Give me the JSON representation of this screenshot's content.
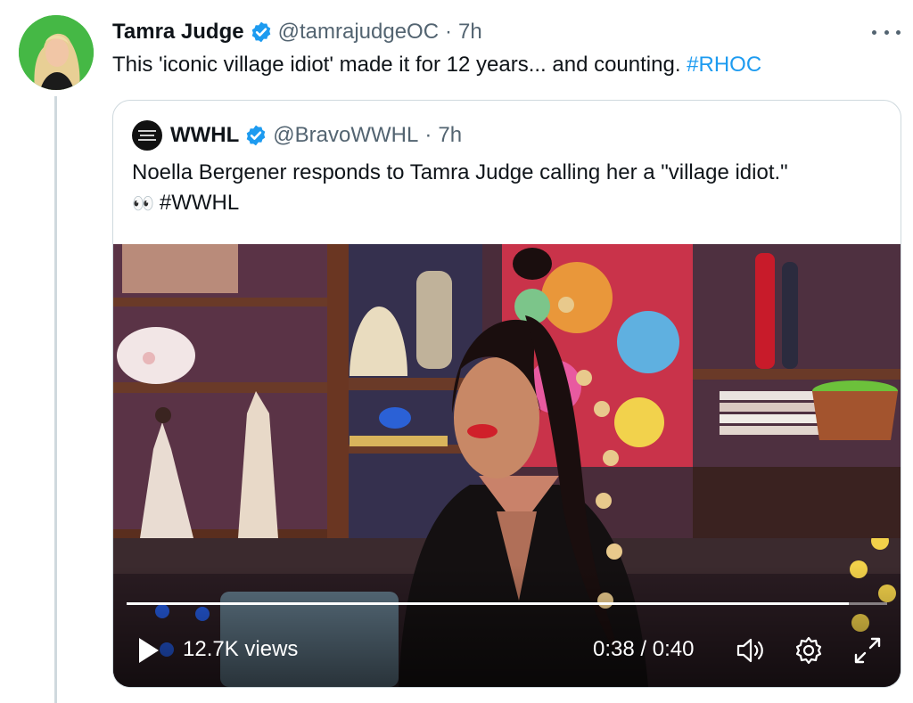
{
  "tweet": {
    "author_name": "Tamra Judge",
    "handle": "@tamrajudgeOC",
    "separator": "·",
    "time": "7h",
    "text": "This 'iconic village idiot' made it for 12 years... and counting.",
    "hashtag": "#RHOC"
  },
  "quote": {
    "author_name": "WWHL",
    "handle": "@BravoWWHL",
    "separator": "·",
    "time": "7h",
    "text": "Noella Bergener responds to Tamra Judge calling her a \"village idiot.\"",
    "emoji": "👀",
    "hashtag": "#WWHL"
  },
  "video": {
    "views": "12.7K views",
    "timer": "0:38 / 0:40",
    "progress": 0.95
  },
  "icons": [
    "verified-badge-icon",
    "more-icon",
    "play-icon",
    "volume-icon",
    "settings-icon",
    "fullscreen-icon"
  ],
  "colors": {
    "link": "#1d9bf0",
    "text": "#0f1419",
    "muted": "#536471",
    "border": "#cfd9de",
    "verified": "#1d9bf0"
  }
}
